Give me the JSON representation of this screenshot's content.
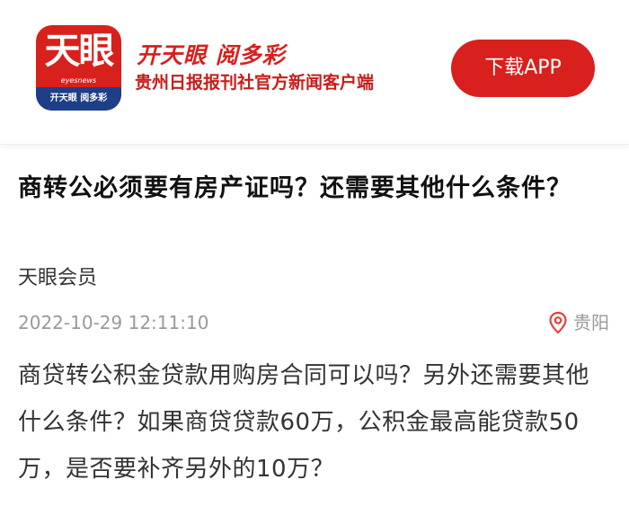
{
  "banner": {
    "logo": {
      "main_text": "天眼",
      "sub_text": "eyesnews",
      "bar_text": "开天眼 阅多彩"
    },
    "slogan": "开天眼  阅多彩",
    "subtitle": "贵州日报报刊社官方新闻客户端",
    "download_label": "下载APP",
    "accent_color": "#d8201c",
    "logo_bar_color": "#1d3f87"
  },
  "article": {
    "title": "商转公必须要有房产证吗？还需要其他什么条件？",
    "author": "天眼会员",
    "timestamp": "2022-10-29 12:11:10",
    "location": "贵阳",
    "location_icon": "location-pin-icon",
    "body": "商贷转公积金贷款用购房合同可以吗？另外还需要其他什么条件？如果商贷贷款60万，公积金最高能贷款50万，是否要补齐另外的10万？"
  }
}
